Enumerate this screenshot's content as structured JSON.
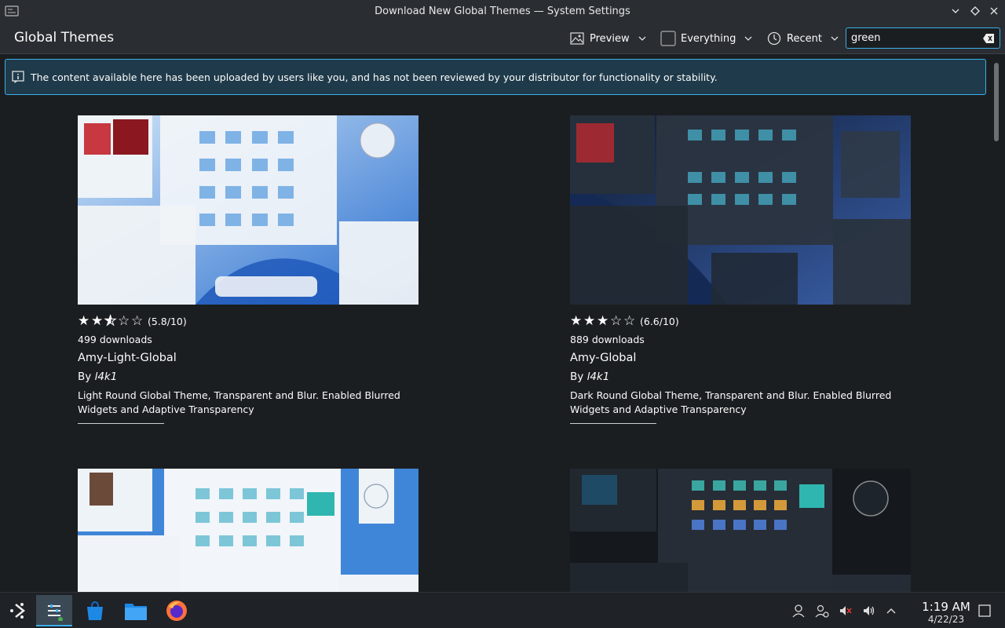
{
  "window": {
    "title": "Download New Global Themes — System Settings"
  },
  "header": {
    "page_title": "Global Themes",
    "view_label": "Preview",
    "filter_label": "Everything",
    "sort_label": "Recent",
    "search_value": "green"
  },
  "banner": {
    "text": "The content available here has been uploaded by users like you, and has not been reviewed by your distributor for functionality or stability."
  },
  "cards": [
    {
      "rating": "(5.8/10)",
      "stars": [
        1,
        1,
        0.5,
        0,
        0
      ],
      "downloads": "499 downloads",
      "name": "Amy-Light-Global",
      "by": "By",
      "author": "l4k1",
      "desc": "Light Round Global Theme, Transparent and Blur. Enabled Blurred Widgets and Adaptive Transparency",
      "theme": "light"
    },
    {
      "rating": "(6.6/10)",
      "stars": [
        1,
        1,
        1,
        0,
        0
      ],
      "downloads": "889 downloads",
      "name": "Amy-Global",
      "by": "By",
      "author": "l4k1",
      "desc": "Dark Round Global Theme, Transparent and Blur. Enabled Blurred Widgets and Adaptive Transparency",
      "theme": "dark"
    },
    {
      "theme": "light2"
    },
    {
      "theme": "dark2"
    }
  ],
  "taskbar": {
    "time": "1:19 AM",
    "date": "4/22/23"
  },
  "colors": {
    "accent": "#3daee9",
    "background": "#1b1e20",
    "header": "#2a2e32"
  }
}
